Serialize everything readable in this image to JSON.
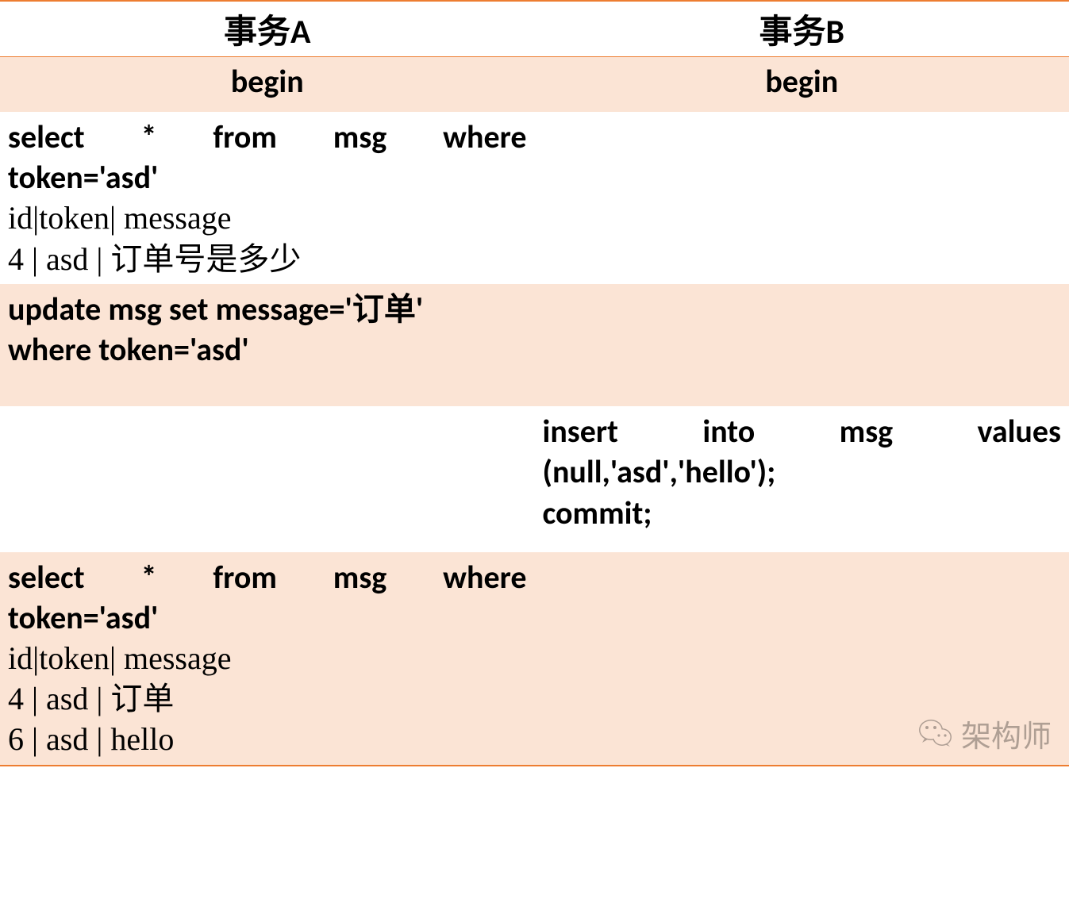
{
  "headers": {
    "colA": "事务A",
    "colB": "事务B"
  },
  "rows": {
    "begin": {
      "a": "begin",
      "b": "begin"
    },
    "r1": {
      "a_sql_line1": "select * from msg where",
      "a_sql_line2": "token='asd'",
      "a_res_hdr": "id|token| message",
      "a_res_row1": "4 | asd  | 订单号是多少"
    },
    "r2": {
      "a_sql_line1": "update msg set message='订单'",
      "a_sql_line2": "where token='asd'"
    },
    "r3": {
      "b_sql_line1": "insert into msg values",
      "b_sql_line2": "(null,'asd','hello');",
      "b_sql_line3": "commit;"
    },
    "r4": {
      "a_sql_line1": "select * from msg where",
      "a_sql_line2": "token='asd'",
      "a_res_hdr": "id|token| message",
      "a_res_row1": "4 | asd  | 订单",
      "a_res_row2": "6 | asd  | hello"
    }
  },
  "watermark": {
    "text": "架构师"
  }
}
